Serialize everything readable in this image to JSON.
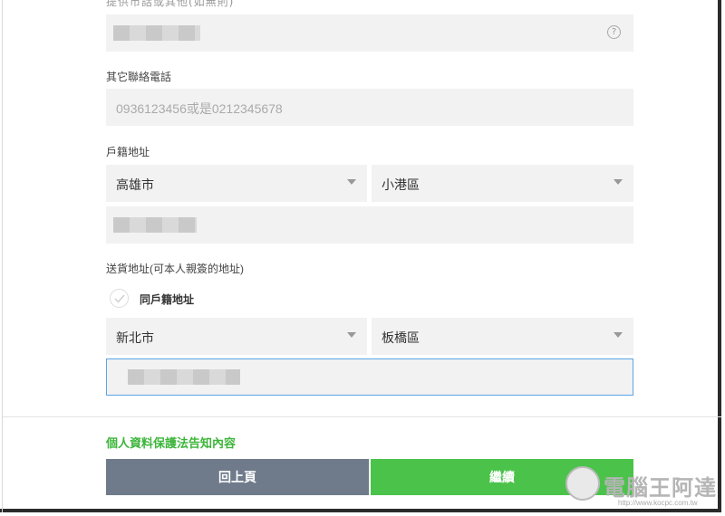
{
  "form": {
    "top_field_label_cut": "提供市話或其他(如無則)",
    "top_field_help": "?",
    "other_phone": {
      "label": "其它聯絡電話",
      "placeholder": "0936123456或是0212345678"
    },
    "household_address": {
      "label": "戶籍地址",
      "city": "高雄市",
      "district": "小港區"
    },
    "delivery_address": {
      "label": "送貨地址(可本人親簽的地址)",
      "same_as_household_label": "同戶籍地址",
      "city": "新北市",
      "district": "板橋區"
    },
    "privacy_link": "個人資料保護法告知內容",
    "back_button": "回上頁",
    "continue_button": "繼續"
  },
  "watermark": {
    "brand": "電腦王阿達",
    "url": "http://www.kocpc.com.tw"
  },
  "colors": {
    "field_bg": "#f2f2f2",
    "focus_border": "#5ba5e6",
    "accent_green": "#4bc34b",
    "link_green": "#3db53a",
    "back_button_bg": "#6f7b8b"
  }
}
